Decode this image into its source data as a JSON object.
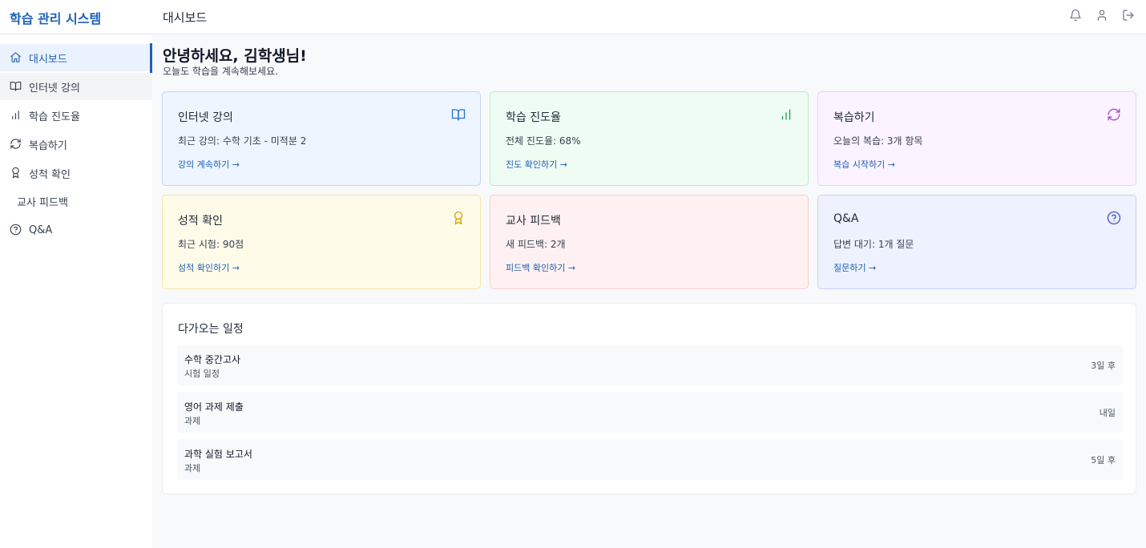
{
  "app": {
    "brand": "학습 관리 시스템",
    "page_heading": "대시보드"
  },
  "header_icons": [
    "bell-icon",
    "user-icon",
    "logout-icon"
  ],
  "sidebar": {
    "items": [
      {
        "label": "대시보드",
        "icon": "home-icon"
      },
      {
        "label": "인터넷 강의",
        "icon": "book-icon"
      },
      {
        "label": "학습 진도율",
        "icon": "bar-chart-icon"
      },
      {
        "label": "복습하기",
        "icon": "refresh-icon"
      },
      {
        "label": "성적 확인",
        "icon": "award-icon"
      },
      {
        "label": "교사 피드백",
        "icon": ""
      },
      {
        "label": "Q&A",
        "icon": "help-circle-icon"
      }
    ]
  },
  "main": {
    "greeting": "안녕하세요, 김학생님!",
    "subgreeting": "오늘도 학습을 계속해보세요.",
    "cards": [
      {
        "title": "인터넷 강의",
        "desc": "최근 강의: 수학 기초 - 미적분 2",
        "link": "강의 계속하기 →",
        "icon": "book-icon",
        "color": "#2b73d0"
      },
      {
        "title": "학습 진도율",
        "desc": "전체 진도율: 68%",
        "link": "진도 확인하기 →",
        "icon": "bar-chart-icon",
        "color": "#22a153"
      },
      {
        "title": "복습하기",
        "desc": "오늘의 복습: 3개 항목",
        "link": "복습 시작하기 →",
        "icon": "refresh-icon",
        "color": "#a443d6"
      },
      {
        "title": "성적 확인",
        "desc": "최근 시험: 90점",
        "link": "성적 확인하기 →",
        "icon": "award-icon",
        "color": "#d6a300"
      },
      {
        "title": "교사 피드백",
        "desc": "새 피드백: 2개",
        "link": "피드백 확인하기 →",
        "icon": "",
        "color": "#e05252"
      },
      {
        "title": "Q&A",
        "desc": "답변 대기: 1개 질문",
        "link": "질문하기 →",
        "icon": "help-circle-icon",
        "color": "#4152c7"
      }
    ],
    "schedule": {
      "title": "다가오는 일정",
      "items": [
        {
          "name": "수학 중간고사",
          "type": "시험 일정",
          "when": "3일 후"
        },
        {
          "name": "영어 과제 제출",
          "type": "과제",
          "when": "내일"
        },
        {
          "name": "과학 실험 보고서",
          "type": "과제",
          "when": "5일 후"
        }
      ]
    }
  }
}
